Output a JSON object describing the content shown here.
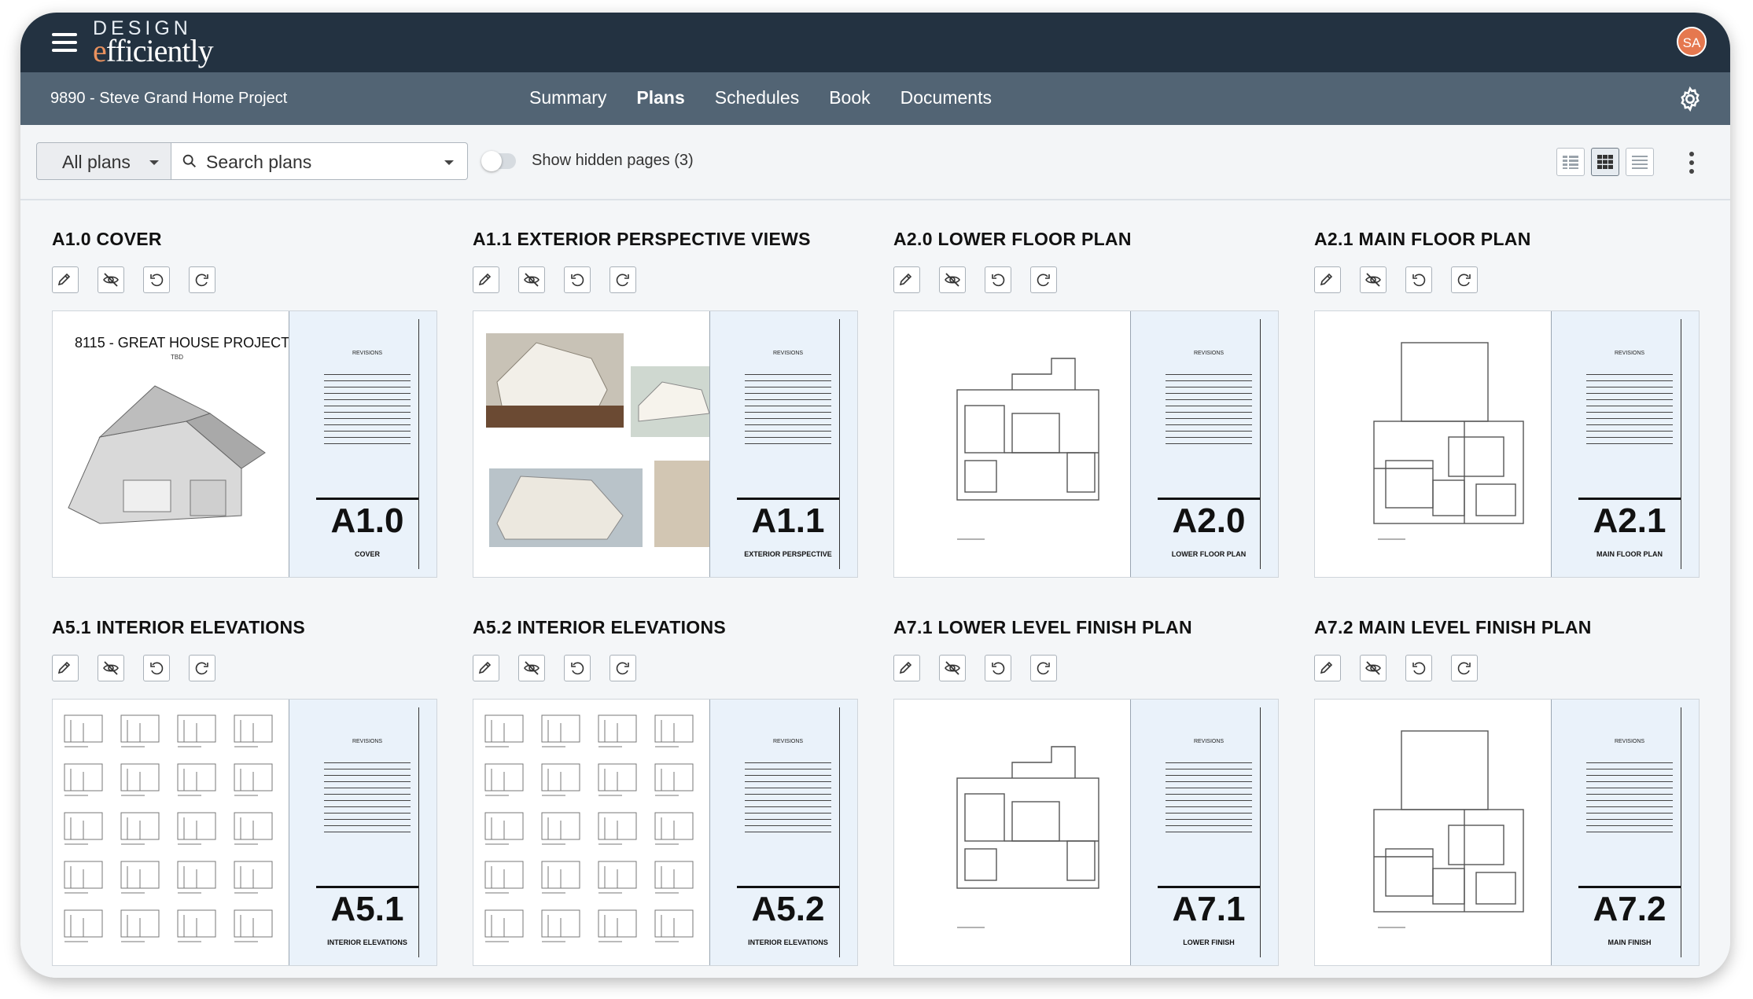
{
  "app": {
    "logo_top": "DESIGN",
    "logo_bottom_accent": "e",
    "logo_bottom_rest": "fficiently",
    "user_initials": "SA"
  },
  "project": {
    "title": "9890 - Steve Grand Home Project"
  },
  "nav": {
    "tabs": [
      {
        "label": "Summary"
      },
      {
        "label": "Plans"
      },
      {
        "label": "Schedules"
      },
      {
        "label": "Book"
      },
      {
        "label": "Documents"
      }
    ],
    "active": "Plans"
  },
  "toolbar": {
    "filter_label": "All plans",
    "search_placeholder": "Search plans",
    "hidden_toggle_label": "Show hidden pages (3)",
    "hidden_toggle_on": false,
    "active_view": "grid"
  },
  "sheet_common": {
    "revisions": "REVISIONS"
  },
  "cards": [
    {
      "title": "A1.0 COVER",
      "number": "A1.0",
      "subtitle": "COVER",
      "cover_caption": "8115 - GREAT HOUSE PROJECT",
      "cover_sub": "TBD"
    },
    {
      "title": "A1.1 EXTERIOR PERSPECTIVE VIEWS",
      "number": "A1.1",
      "subtitle": "EXTERIOR PERSPECTIVE"
    },
    {
      "title": "A2.0 LOWER FLOOR PLAN",
      "number": "A2.0",
      "subtitle": "LOWER FLOOR PLAN"
    },
    {
      "title": "A2.1 MAIN FLOOR PLAN",
      "number": "A2.1",
      "subtitle": "MAIN FLOOR PLAN"
    },
    {
      "title": "A5.1 INTERIOR ELEVATIONS",
      "number": "A5.1",
      "subtitle": "INTERIOR ELEVATIONS"
    },
    {
      "title": "A5.2 INTERIOR ELEVATIONS",
      "number": "A5.2",
      "subtitle": "INTERIOR ELEVATIONS"
    },
    {
      "title": "A7.1 LOWER LEVEL FINISH PLAN",
      "number": "A7.1",
      "subtitle": "LOWER FINISH"
    },
    {
      "title": "A7.2 MAIN LEVEL FINISH PLAN",
      "number": "A7.2",
      "subtitle": "MAIN FINISH"
    }
  ],
  "colors": {
    "topbar": "#233241",
    "subbar": "#526474",
    "avatar": "#e5784f",
    "title_block": "#eaf2fa"
  }
}
